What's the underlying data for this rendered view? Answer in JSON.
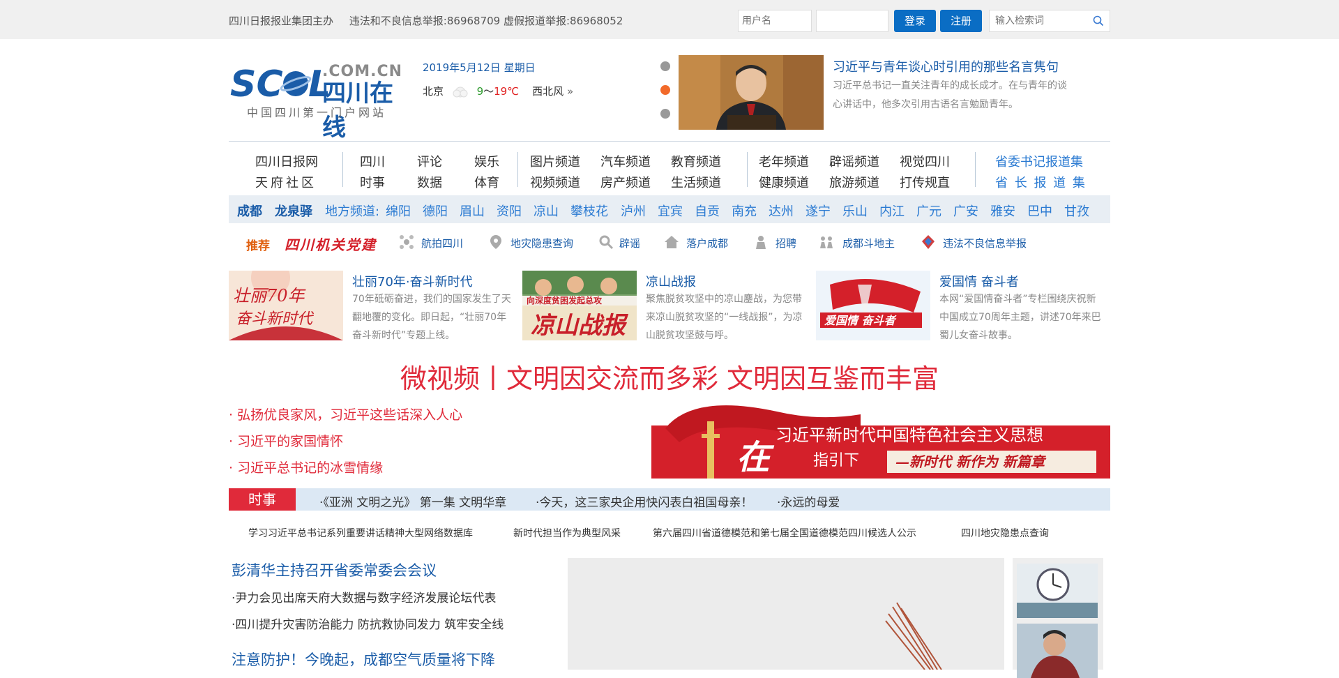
{
  "topbar": {
    "org": "四川日报报业集团主办",
    "report": "违法和不良信息举报:86968709 虚假报道举报:86968052",
    "username_placeholder": "用户名",
    "password_placeholder": "",
    "login": "登录",
    "register": "注册",
    "search_placeholder": "输入检索词"
  },
  "logo": {
    "main": "SC L",
    "suffix": ".COM.CN",
    "cn": "四川在线",
    "slogan": "中国四川第一门户网站"
  },
  "date": "2019年5月12日 星期日",
  "weather": {
    "city": "北京",
    "temp_low": "9",
    "sep": "～",
    "temp_high": "19℃",
    "wind": "西北风",
    "more": "»"
  },
  "feature": {
    "title": "习近平与青年谈心时引用的那些名言隽句",
    "desc": "习近平总书记一直关注青年的成长成才。在与青年的谈心讲话中，他多次引用古语名言勉励青年。"
  },
  "nav": {
    "col1": [
      "四川日报网",
      "天府社区"
    ],
    "col2": [
      "四川",
      "时事"
    ],
    "col3": [
      "评论",
      "数据"
    ],
    "col4": [
      "娱乐",
      "体育"
    ],
    "col5": [
      "图片频道",
      "视频频道"
    ],
    "col6": [
      "汽车频道",
      "房产频道"
    ],
    "col7": [
      "教育频道",
      "生活频道"
    ],
    "col8": [
      "老年频道",
      "健康频道"
    ],
    "col9": [
      "辟谣频道",
      "旅游频道"
    ],
    "col10": [
      "视觉四川",
      "打传规直"
    ],
    "col11": [
      "省委书记报道集",
      "省 长 报 道 集"
    ]
  },
  "local": {
    "featured": [
      "成都",
      "龙泉驿"
    ],
    "label": "地方频道:",
    "cities": [
      "绵阳",
      "德阳",
      "眉山",
      "资阳",
      "凉山",
      "攀枝花",
      "泸州",
      "宜宾",
      "自贡",
      "南充",
      "达州",
      "遂宁",
      "乐山",
      "内江",
      "广元",
      "广安",
      "雅安",
      "巴中",
      "甘孜"
    ]
  },
  "recommend": {
    "label": "推荐",
    "brand": "四川机关党建",
    "items": [
      "航拍四川",
      "地灾隐患查询",
      "辟谣",
      "落户成都",
      "招聘",
      "成都斗地主",
      "违法不良信息举报"
    ]
  },
  "cards": [
    {
      "title": "壮丽70年·奋斗新时代",
      "desc": "70年砥砺奋进，我们的国家发生了天翻地覆的变化。即日起，“壮丽70年 奋斗新时代”专题上线。",
      "img_text": "壮丽70年 奋斗新时代"
    },
    {
      "title": "凉山战报",
      "desc": "聚焦脱贫攻坚中的凉山鏖战，为您带来凉山脱贫攻坚的“一线战报”，为凉山脱贫攻坚鼓与呼。",
      "img_text": "凉山战报",
      "img_sub": "向深度贫困发起总攻"
    },
    {
      "title": "爱国情 奋斗者",
      "desc": "本网“爱国情奋斗者”专栏围绕庆祝新中国成立70周年主题，讲述70年来巴蜀儿女奋斗故事。",
      "img_text": "爱国情 奋斗者"
    }
  ],
  "headline": "微视频丨文明因交流而多彩 文明因互鉴而丰富",
  "red_links": [
    "· 弘扬优良家风，习近平这些话深入人心",
    "· 习近平的家国情怀",
    "· 习近平总书记的冰雪情缘"
  ],
  "banner": {
    "char": "在",
    "line1": "习近平新时代中国特色社会主义思想",
    "line2": "指引下",
    "line3": "—新时代 新作为 新篇章"
  },
  "shishi": {
    "tag": "时事",
    "items": [
      "·《亚洲 文明之光》 第一集 文明华章",
      "·今天，这三家央企用快闪表白祖国母亲！",
      "·永远的母爱"
    ]
  },
  "sublinks": [
    "学习习近平总书记系列重要讲话精神大型网络数据库",
    "新时代担当作为典型风采",
    "第六届四川省道德模范和第七届全国道德模范四川候选人公示",
    "四川地灾隐患点查询"
  ],
  "news": [
    {
      "text": "彭清华主持召开省委常委会会议",
      "kind": "big"
    },
    {
      "text": "·尹力会见出席天府大数据与数字经济发展论坛代表",
      "kind": "small"
    },
    {
      "text": "·四川提升灾害防治能力 防抗救协同发力 筑牢安全线",
      "kind": "small"
    },
    {
      "text": "注意防护！今晚起，成都空气质量将下降",
      "kind": "big"
    }
  ],
  "colors": {
    "brand_blue": "#1a5ca8",
    "link_blue": "#2a7ad2",
    "accent_red": "#e02a3a",
    "button_blue": "#0a6dc4"
  }
}
